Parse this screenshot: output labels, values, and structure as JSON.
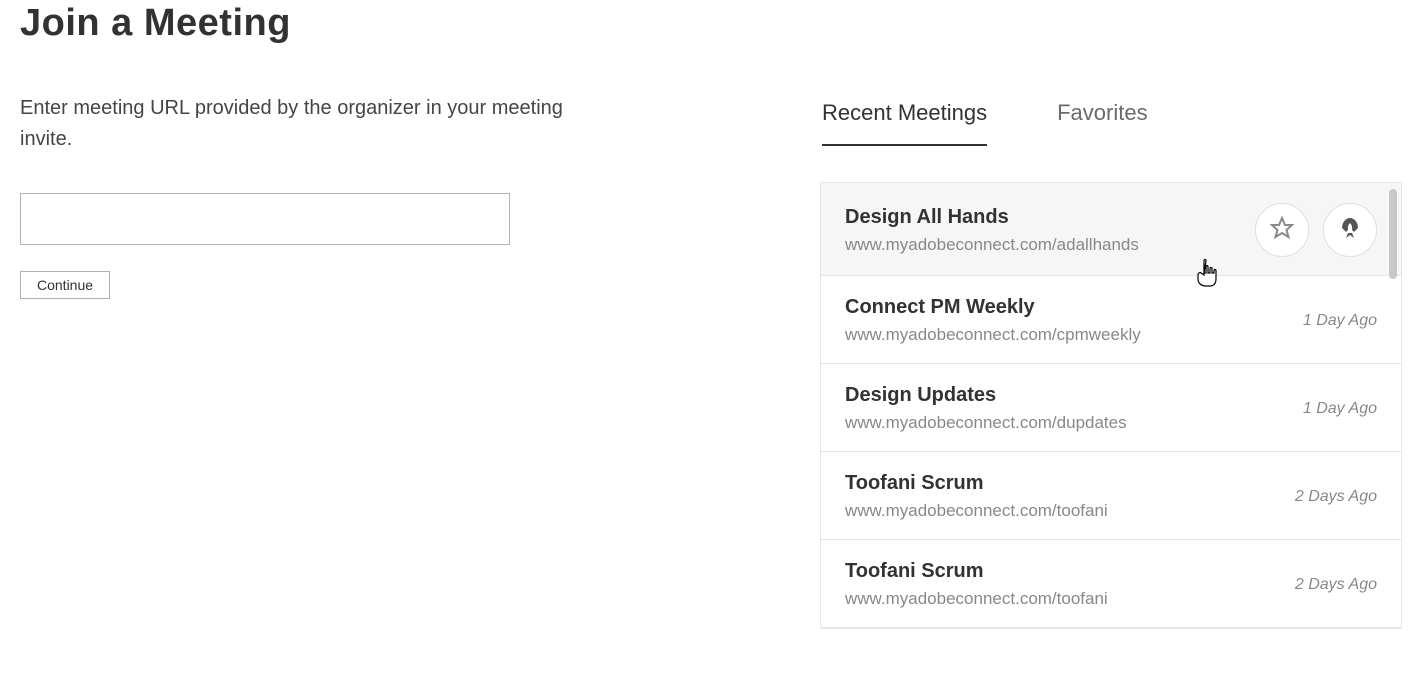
{
  "page": {
    "title": "Join a Meeting",
    "instructions": "Enter meeting URL provided by the organizer in your meeting invite.",
    "url_value": "",
    "continue_label": "Continue"
  },
  "tabs": {
    "recent_label": "Recent Meetings",
    "favorites_label": "Favorites",
    "active": "recent"
  },
  "meetings": [
    {
      "title": "Design All Hands",
      "url": "www.myadobeconnect.com/adallhands",
      "time": "",
      "hovered": true
    },
    {
      "title": "Connect PM Weekly",
      "url": "www.myadobeconnect.com/cpmweekly",
      "time": "1 Day Ago",
      "hovered": false
    },
    {
      "title": "Design Updates",
      "url": "www.myadobeconnect.com/dupdates",
      "time": "1 Day Ago",
      "hovered": false
    },
    {
      "title": "Toofani Scrum",
      "url": "www.myadobeconnect.com/toofani",
      "time": "2 Days Ago",
      "hovered": false
    },
    {
      "title": "Toofani Scrum",
      "url": "www.myadobeconnect.com/toofani",
      "time": "2 Days Ago",
      "hovered": false
    }
  ]
}
